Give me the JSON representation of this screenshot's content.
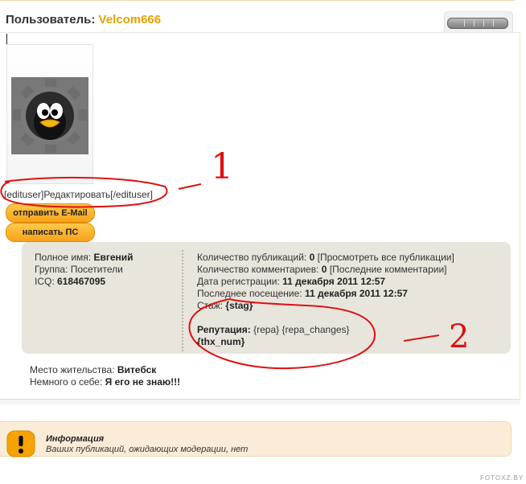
{
  "header": {
    "label": "Пользователь:",
    "username": "Velcom666"
  },
  "profile": {
    "edit_link": "[edituser]Редактировать[/edituser]",
    "btn_email": "отправить E-Mail",
    "btn_pm": "написать ПС"
  },
  "details_left": {
    "fullname_label": "Полное имя:",
    "fullname": "Евгений",
    "group_label": "Группа:",
    "group": "Посетители",
    "icq_label": "ICQ:",
    "icq": "618467095"
  },
  "details_right": {
    "pubs_label": "Количество публикаций:",
    "pubs_count": "0",
    "pubs_link": "[Просмотреть все публикации]",
    "comments_label": "Количество комментариев:",
    "comments_count": "0",
    "comments_link": "[Последние комментарии]",
    "reg_label": "Дата регистрации:",
    "reg_date": "11 декабря 2011 12:57",
    "last_label": "Последнее посещение:",
    "last_date": "11 декабря 2011 12:57",
    "stazh_label": "Стаж:",
    "stazh": "{stag}",
    "rep_label": "Репутация:",
    "rep": "{repa}",
    "rep_changes": "{repa_changes}",
    "thx": "{thx_num}"
  },
  "lower": {
    "city_label": "Место жительства:",
    "city": "Витебск",
    "about_label": "Немного о себе:",
    "about": "Я его не знаю!!!"
  },
  "info": {
    "title": "Информация",
    "text": "Ваших публикаций, ожидающих модерации, нет"
  },
  "annotations": {
    "one": "1",
    "two": "2"
  },
  "watermark": "FOTOXZ.BY"
}
